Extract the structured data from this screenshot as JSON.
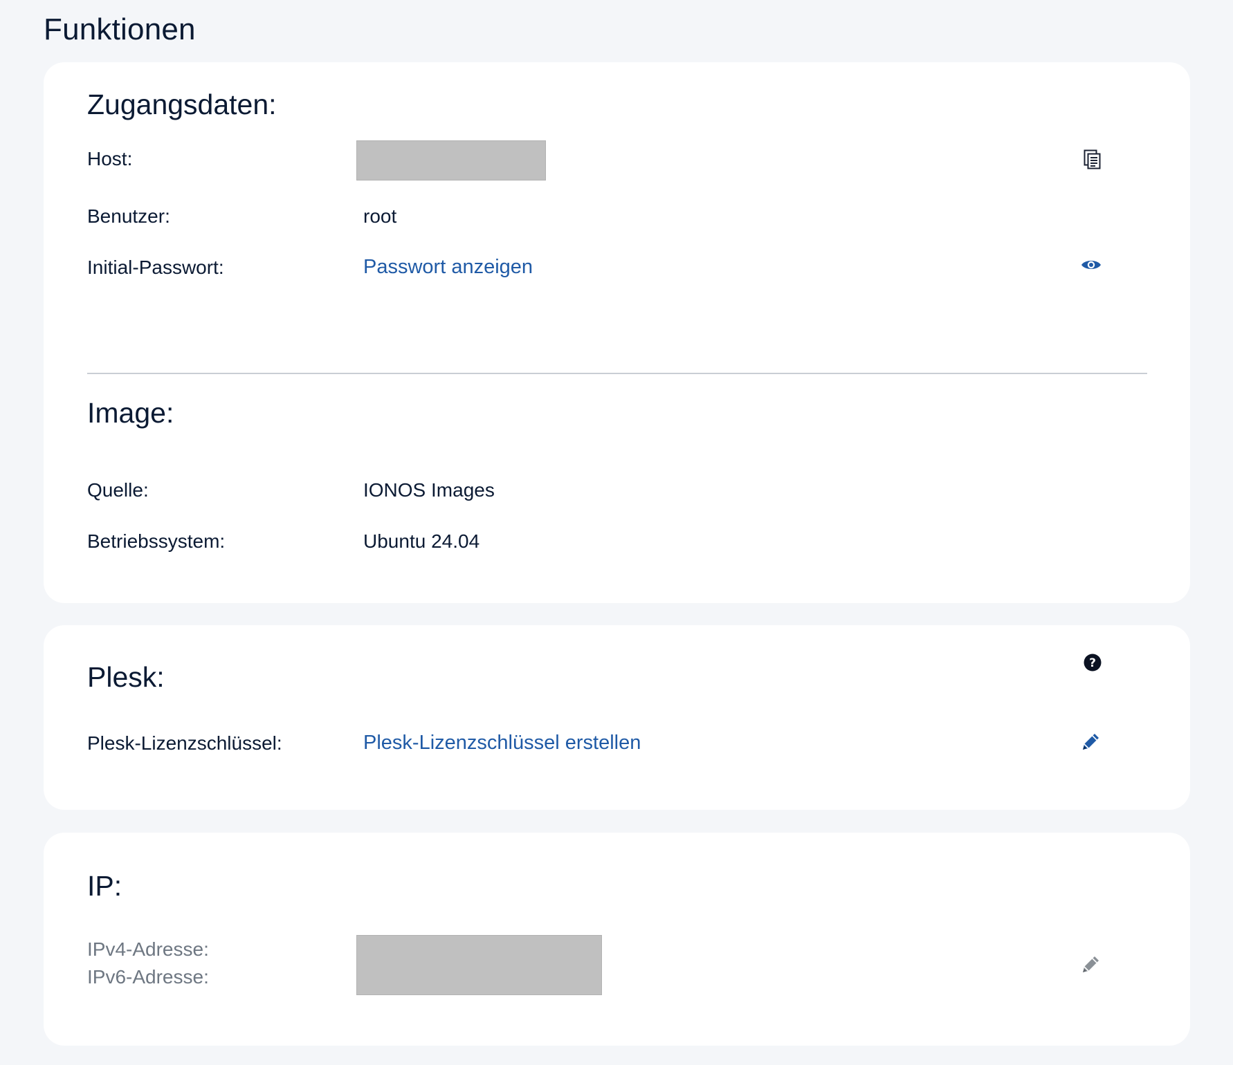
{
  "page": {
    "title": "Funktionen"
  },
  "access": {
    "title": "Zugangsdaten:",
    "host_label": "Host:",
    "user_label": "Benutzer:",
    "user_value": "root",
    "password_label": "Initial-Passwort:",
    "password_link": "Passwort anzeigen",
    "host_action_icon": "copy-icon",
    "password_action_icon": "eye-icon"
  },
  "image": {
    "title": "Image:",
    "source_label": "Quelle:",
    "source_value": "IONOS Images",
    "os_label": "Betriebssystem:",
    "os_value": "Ubuntu 24.04"
  },
  "plesk": {
    "title": "Plesk:",
    "license_label": "Plesk-Lizenzschlüssel:",
    "license_link": "Plesk-Lizenzschlüssel erstellen",
    "help_icon": "question-circle-icon",
    "edit_icon": "pencil-icon"
  },
  "ip": {
    "title": "IP:",
    "ipv4_label": "IPv4-Adresse:",
    "ipv6_label": "IPv6-Adresse:",
    "edit_icon": "pencil-icon"
  },
  "colors": {
    "link": "#1f5aa6",
    "text": "#0b1a33",
    "muted": "#6e7782",
    "background": "#f4f6f9",
    "card": "#ffffff",
    "redaction": "#c0c0c0"
  }
}
